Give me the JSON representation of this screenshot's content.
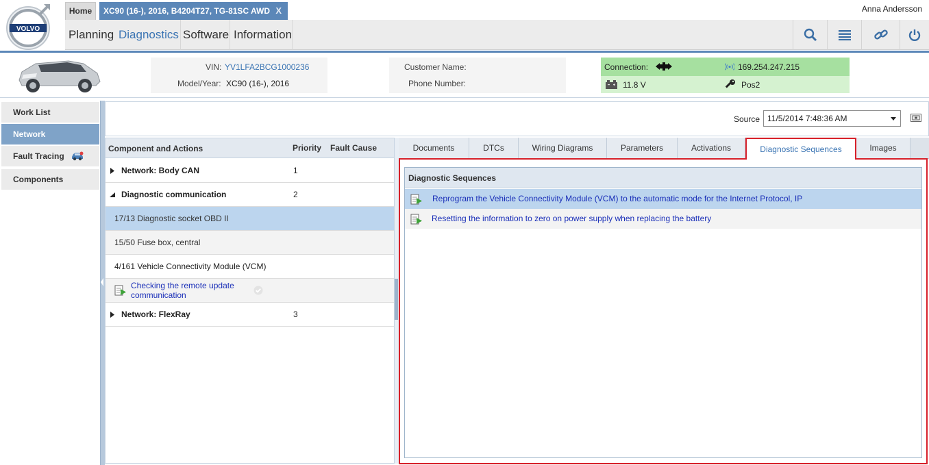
{
  "header": {
    "home_tab": "Home",
    "vehicle_tab": "XC90 (16-), 2016, B4204T27, TG-81SC AWD",
    "vehicle_tab_close": "X",
    "user": "Anna Andersson",
    "logo_text": "VOLVO",
    "menu": [
      "Planning",
      "Diagnostics",
      "Software",
      "Information"
    ],
    "active_menu": "Diagnostics",
    "tools": [
      "search-icon",
      "list-icon",
      "link-icon",
      "power-icon"
    ]
  },
  "vehicle": {
    "vin_label": "VIN:",
    "vin": "YV1LFA2BCG1000236",
    "model_label": "Model/Year:",
    "model": "XC90 (16-), 2016",
    "customer_label": "Customer Name:",
    "customer": "",
    "phone_label": "Phone Number:",
    "phone": ""
  },
  "connection": {
    "label": "Connection:",
    "ip": "169.254.247.215",
    "voltage": "11.8 V",
    "position": "Pos2",
    "colors": {
      "top": "#a6e0a0",
      "bottom": "#d5f2d0"
    }
  },
  "leftnav": {
    "items": [
      "Work List",
      "Network",
      "Fault Tracing",
      "Components"
    ],
    "active": "Network"
  },
  "source": {
    "label": "Source",
    "value": "11/5/2014 7:48:36 AM"
  },
  "components": {
    "headers": {
      "component": "Component and Actions",
      "priority": "Priority",
      "fault": "Fault Cause"
    },
    "rows": [
      {
        "type": "group",
        "expanded": false,
        "label": "Network: Body CAN",
        "priority": "1"
      },
      {
        "type": "group",
        "expanded": true,
        "label": "Diagnostic communication",
        "priority": "2"
      },
      {
        "type": "item",
        "label": "17/13 Diagnostic socket OBD II",
        "selected": true
      },
      {
        "type": "item",
        "label": "15/50 Fuse box, central"
      },
      {
        "type": "item",
        "label": "4/161 Vehicle Connectivity Module (VCM)"
      },
      {
        "type": "action",
        "label_line1": "Checking the remote update",
        "label_line2": "communication"
      },
      {
        "type": "group",
        "expanded": false,
        "label": "Network: FlexRay",
        "priority": "3"
      }
    ]
  },
  "tabs": {
    "items": [
      "Documents",
      "DTCs",
      "Wiring Diagrams",
      "Parameters",
      "Activations",
      "Diagnostic Sequences",
      "Images"
    ],
    "active": "Diagnostic Sequences"
  },
  "sequences": {
    "title": "Diagnostic Sequences",
    "items": [
      "Reprogram the Vehicle Connectivity Module (VCM) to the automatic mode for the Internet Protocol, IP",
      "Resetting the information to zero on power supply when replacing the battery"
    ]
  },
  "colors": {
    "accent": "#3a74b3",
    "highlight": "#d7202a",
    "selection": "#bcd5ee"
  }
}
